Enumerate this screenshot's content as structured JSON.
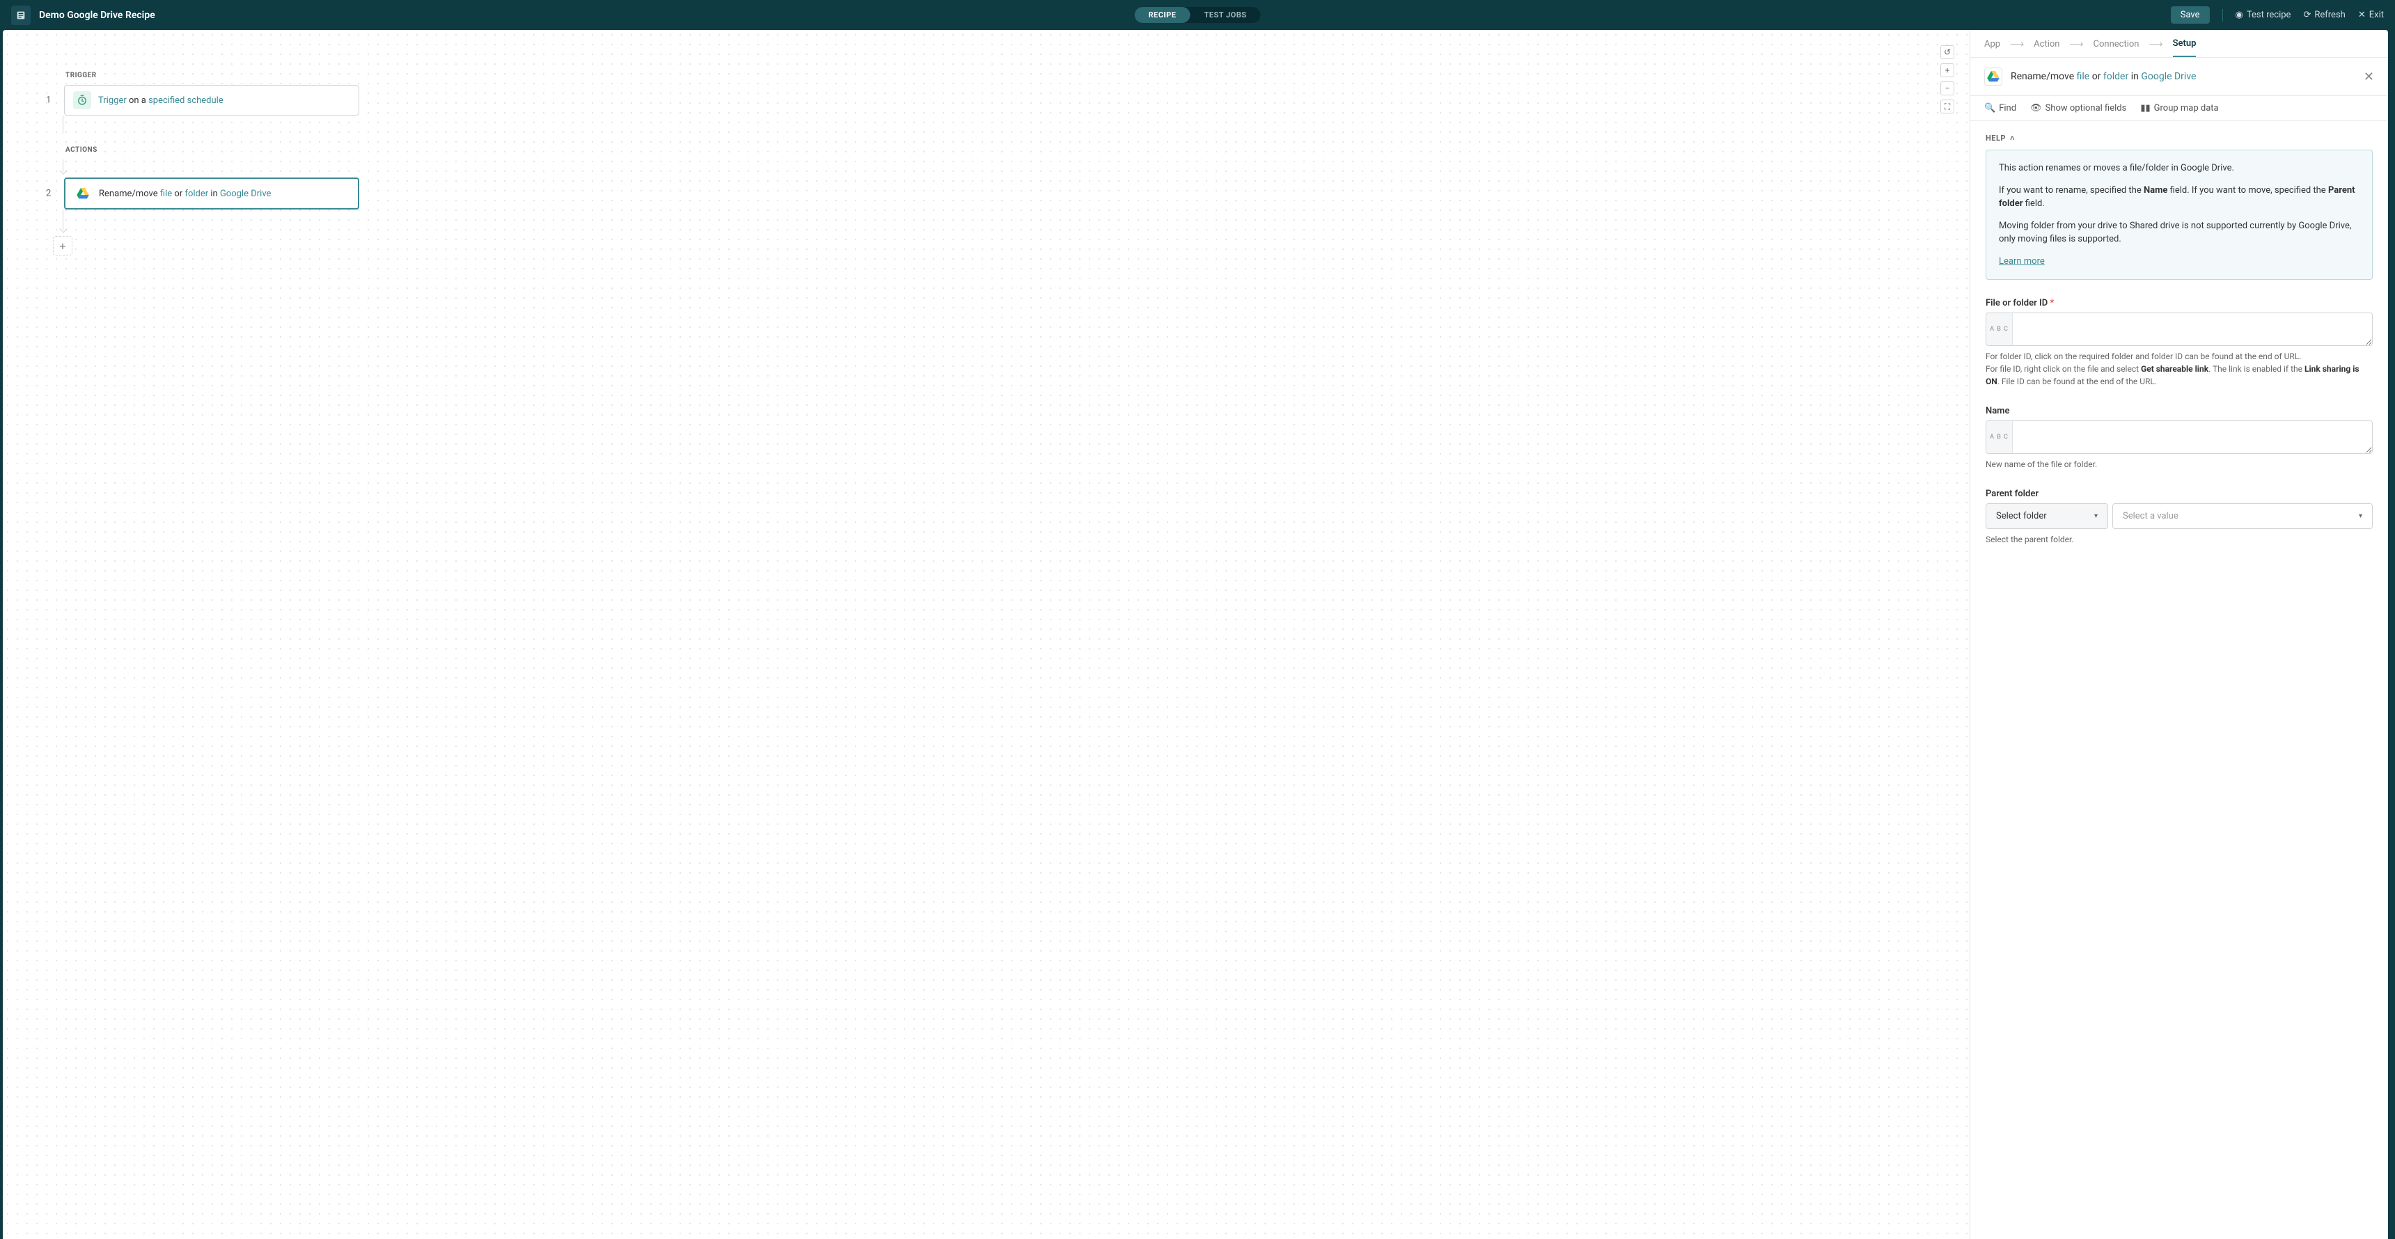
{
  "header": {
    "title": "Demo Google Drive Recipe",
    "tabs": {
      "recipe": "RECIPE",
      "test_jobs": "TEST JOBS"
    },
    "save": "Save",
    "test_recipe": "Test recipe",
    "refresh": "Refresh",
    "exit": "Exit"
  },
  "flow": {
    "trigger_label": "TRIGGER",
    "actions_label": "ACTIONS",
    "step1": {
      "num": "1",
      "a": "Trigger",
      "b": " on a ",
      "c": "specified schedule"
    },
    "step2": {
      "num": "2",
      "a": "Rename/move ",
      "b": "file",
      "c": " or ",
      "d": "folder",
      "e": " in ",
      "f": "Google Drive"
    }
  },
  "crumbs": {
    "app": "App",
    "action": "Action",
    "connection": "Connection",
    "setup": "Setup"
  },
  "panel": {
    "title_a": "Rename/move ",
    "title_b": "file",
    "title_c": " or ",
    "title_d": "folder",
    "title_e": " in ",
    "title_f": "Google Drive",
    "find": "Find",
    "optional": "Show optional fields",
    "group": "Group map data",
    "help_label": "HELP",
    "help_p1": "This action renames or moves a file/folder in Google Drive.",
    "help_p2a": "If you want to rename, specified the ",
    "help_p2b": "Name",
    "help_p2c": " field. If you want to move, specified the ",
    "help_p2d": "Parent folder",
    "help_p2e": " field.",
    "help_p3": "Moving folder from your drive to Shared drive is not supported currently by Google Drive, only moving files is supported.",
    "learn_more": "Learn more"
  },
  "fields": {
    "id_label": "File or folder ID",
    "id_help1": "For folder ID, click on the required folder and folder ID can be found at the end of URL.",
    "id_help2a": "For file ID, right click on the file and select ",
    "id_help2b": "Get shareable link",
    "id_help2c": ". The link is enabled if the ",
    "id_help2d": "Link sharing is ON",
    "id_help2e": ". File ID can be found at the end of the URL.",
    "name_label": "Name",
    "name_help": "New name of the file or folder.",
    "parent_label": "Parent folder",
    "select_folder": "Select folder",
    "select_value": "Select a value",
    "parent_help": "Select the parent folder.",
    "abc": "A B C"
  }
}
